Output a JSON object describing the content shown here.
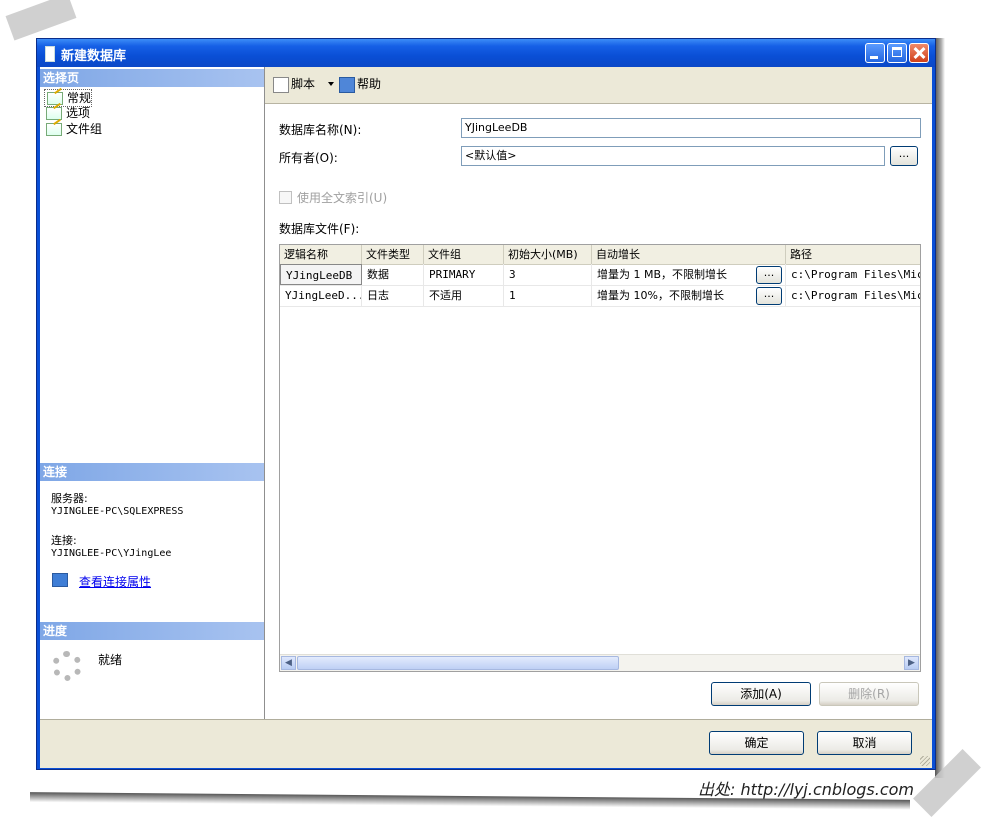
{
  "window": {
    "title": "新建数据库"
  },
  "left": {
    "select_page_header": "选择页",
    "pages": [
      {
        "label": "常规"
      },
      {
        "label": "选项"
      },
      {
        "label": "文件组"
      }
    ],
    "connection_header": "连接",
    "server_label": "服务器:",
    "server_value": "YJINGLEE-PC\\SQLEXPRESS",
    "connection_label": "连接:",
    "connection_value": "YJINGLEE-PC\\YJingLee",
    "view_props_link": "查看连接属性",
    "progress_header": "进度",
    "progress_status": "就绪"
  },
  "toolbar": {
    "script_label": "脚本",
    "help_label": "帮助"
  },
  "form": {
    "db_name_label": "数据库名称(N):",
    "db_name_value": "YJingLeeDB",
    "owner_label": "所有者(O):",
    "owner_value": "<默认值>",
    "ellipsis": "...",
    "fulltext_label": "使用全文索引(U)",
    "files_label": "数据库文件(F):"
  },
  "grid": {
    "headers": [
      "逻辑名称",
      "文件类型",
      "文件组",
      "初始大小(MB)",
      "自动增长",
      "路径"
    ],
    "rows": [
      {
        "name": "YJingLeeDB",
        "type": "数据",
        "group": "PRIMARY",
        "size": "3",
        "growth": "增量为 1 MB，不限制增长",
        "path": "c:\\Program Files\\Micro"
      },
      {
        "name": "YJingLeeD...",
        "type": "日志",
        "group": "不适用",
        "size": "1",
        "growth": "增量为 10%，不限制增长",
        "path": "c:\\Program Files\\Micro"
      }
    ]
  },
  "buttons": {
    "add": "添加(A)",
    "remove": "删除(R)",
    "ok": "确定",
    "cancel": "取消"
  },
  "watermark": "出处: http://lyj.cnblogs.com"
}
